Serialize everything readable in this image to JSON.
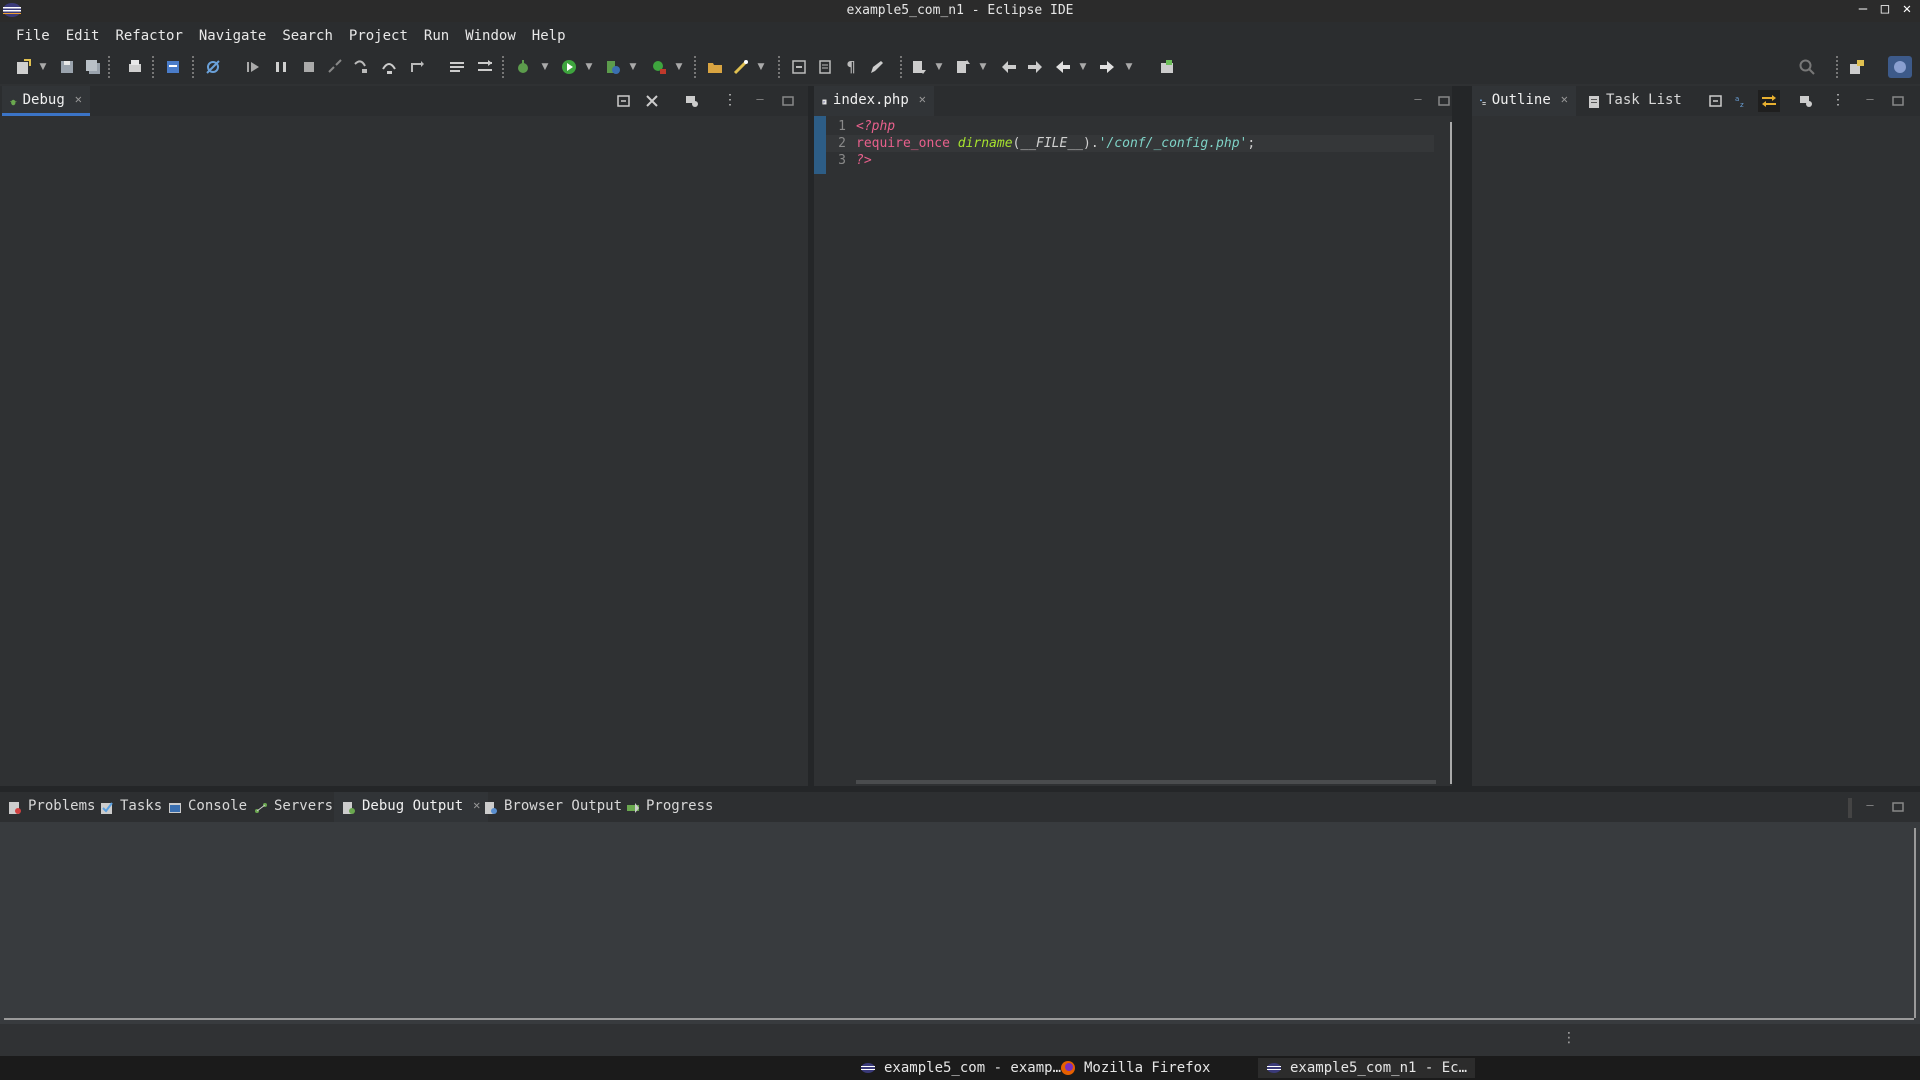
{
  "window": {
    "title": "example5_com_n1 - Eclipse IDE",
    "controls": [
      "–",
      "□",
      "✕"
    ]
  },
  "menu": [
    "File",
    "Edit",
    "Refactor",
    "Navigate",
    "Search",
    "Project",
    "Run",
    "Window",
    "Help"
  ],
  "left_panel": {
    "tab": "Debug"
  },
  "editor": {
    "tab": "index.php",
    "lines": [
      {
        "n": "1",
        "text": "<?php"
      },
      {
        "n": "2",
        "text_parts": [
          "require_once",
          " ",
          "dirname",
          "(",
          "__FILE__",
          ").",
          "'/conf/_config.php'",
          ";"
        ]
      },
      {
        "n": "3",
        "text": "?>"
      }
    ]
  },
  "right_panel": {
    "tabs": [
      "Outline",
      "Task List"
    ]
  },
  "bottom_panel": {
    "tabs": [
      "Problems",
      "Tasks",
      "Console",
      "Servers",
      "Debug Output",
      "Browser Output",
      "Progress"
    ],
    "active_tab": "Debug Output"
  },
  "taskbar": {
    "items": [
      "example5_com - examp…",
      "Mozilla Firefox",
      "example5_com_n1 - Ec…"
    ]
  },
  "colors": {
    "accent": "#3b74c7",
    "keyword": "#e8608c",
    "function": "#a6e22e",
    "string": "#7fd3c7"
  }
}
